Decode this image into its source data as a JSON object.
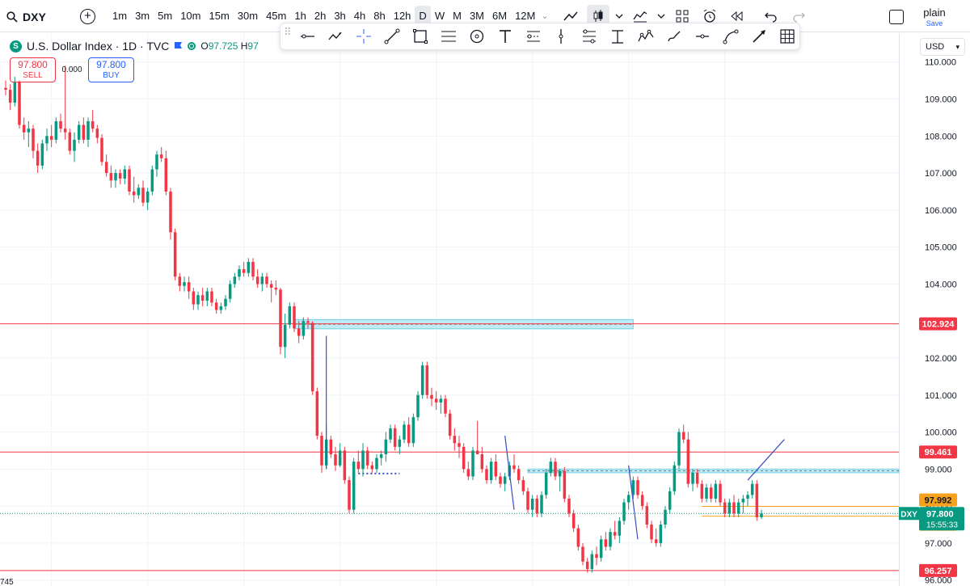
{
  "toolbar": {
    "symbol": "DXY",
    "intervals": [
      "1m",
      "3m",
      "5m",
      "10m",
      "15m",
      "30m",
      "45m",
      "1h",
      "2h",
      "3h",
      "4h",
      "8h",
      "12h",
      "D",
      "W",
      "M",
      "3M",
      "6M",
      "12M"
    ],
    "active_interval": "D",
    "layout_name": "plain",
    "save_label": "Save"
  },
  "legend": {
    "title": "U.S. Dollar Index · 1D · TVC",
    "logo_letter": "S",
    "ohlc_open_key": "O",
    "ohlc_open_value": "97.725",
    "ohlc_high_key": "H",
    "ohlc_high_value": "97"
  },
  "trade": {
    "sell_price": "97.800",
    "sell_label": "SELL",
    "spread": "0.000",
    "buy_price": "97.800",
    "buy_label": "BUY"
  },
  "currency": "USD",
  "bottom_partial_label": "745",
  "colors": {
    "up": "#089981",
    "down": "#f23645",
    "hline": "#f23645",
    "zone": "#71d3e6",
    "orange": "#f7a21b",
    "trend": "#3a4ec4",
    "last_price_bg": "#089981"
  },
  "chart_data": {
    "type": "candlestick",
    "symbol": "DXY",
    "timeframe": "1D",
    "ylim": [
      95.84,
      110.78
    ],
    "y_ticks": [
      110,
      109,
      108,
      107,
      106,
      105,
      104,
      102,
      101,
      100,
      99,
      98,
      97,
      96
    ],
    "y_tick_labels": [
      "110.000",
      "109.000",
      "108.000",
      "107.000",
      "106.000",
      "105.000",
      "104.000",
      "102.000",
      "101.000",
      "100.000",
      "99.000",
      "98.000",
      "97.000",
      "96.000"
    ],
    "horizontal_lines": [
      {
        "price": 102.924,
        "label": "102.924",
        "color": "#f23645"
      },
      {
        "price": 99.461,
        "label": "99.461",
        "color": "#f23645"
      },
      {
        "price": 96.257,
        "label": "96.257",
        "color": "#f23645"
      }
    ],
    "orange_lines": [
      {
        "price": 97.992,
        "label": "97.992"
      },
      {
        "price": 97.727,
        "label": "97.727"
      }
    ],
    "last_price": {
      "symbol": "DXY",
      "price": "97.800",
      "countdown": "15:55:33",
      "value": 97.8
    },
    "zones": [
      {
        "bar_from": 63,
        "bar_to": 137,
        "top": 103.04,
        "bottom": 102.79
      },
      {
        "bar_from": 114,
        "bar_to": 195,
        "top": 99.0,
        "bottom": 98.9
      }
    ],
    "trend_lines": [
      {
        "from_bar": 70,
        "from_price": 99.0,
        "to_bar": 70,
        "to_price": 102.6
      },
      {
        "from_bar": 109,
        "from_price": 99.9,
        "to_bar": 111,
        "to_price": 97.9
      },
      {
        "from_bar": 136,
        "from_price": 99.1,
        "to_bar": 138,
        "to_price": 97.1
      },
      {
        "from_bar": 162,
        "from_price": 98.7,
        "to_bar": 170,
        "to_price": 99.8
      }
    ],
    "dotted_levels": [
      {
        "bar_from": 77,
        "bar_to": 86,
        "price": 98.88
      }
    ],
    "candles": [
      [
        109.3,
        109.5,
        109.1,
        109.25
      ],
      [
        109.25,
        109.4,
        108.7,
        108.9
      ],
      [
        108.9,
        109.6,
        108.8,
        109.45
      ],
      [
        109.45,
        109.5,
        108.2,
        108.3
      ],
      [
        108.3,
        108.5,
        107.9,
        108.1
      ],
      [
        108.1,
        108.4,
        107.7,
        108.2
      ],
      [
        108.2,
        108.3,
        107.4,
        107.6
      ],
      [
        107.6,
        107.8,
        107.0,
        107.2
      ],
      [
        107.2,
        107.9,
        107.1,
        107.8
      ],
      [
        107.8,
        108.2,
        107.6,
        108.0
      ],
      [
        108.0,
        108.3,
        107.7,
        107.9
      ],
      [
        107.9,
        108.5,
        107.8,
        108.4
      ],
      [
        108.4,
        108.6,
        108.1,
        108.2
      ],
      [
        108.2,
        109.9,
        107.9,
        108.1
      ],
      [
        108.1,
        108.2,
        107.5,
        107.6
      ],
      [
        107.6,
        108.1,
        107.3,
        107.9
      ],
      [
        107.9,
        108.4,
        107.8,
        108.3
      ],
      [
        108.3,
        108.5,
        107.8,
        107.9
      ],
      [
        107.9,
        108.5,
        107.7,
        108.4
      ],
      [
        108.4,
        108.7,
        108.1,
        108.2
      ],
      [
        108.2,
        108.3,
        107.8,
        107.95
      ],
      [
        107.95,
        108.05,
        107.2,
        107.3
      ],
      [
        107.3,
        107.5,
        106.9,
        107.0
      ],
      [
        107.0,
        107.2,
        106.6,
        106.8
      ],
      [
        106.8,
        107.1,
        106.6,
        107.0
      ],
      [
        107.0,
        107.1,
        106.7,
        106.85
      ],
      [
        106.85,
        107.2,
        106.7,
        107.1
      ],
      [
        107.1,
        107.2,
        106.4,
        106.5
      ],
      [
        106.5,
        106.9,
        106.2,
        106.4
      ],
      [
        106.4,
        106.7,
        106.3,
        106.6
      ],
      [
        106.6,
        106.8,
        106.1,
        106.2
      ],
      [
        106.2,
        106.6,
        106.0,
        106.5
      ],
      [
        106.5,
        107.2,
        106.4,
        107.1
      ],
      [
        107.1,
        107.6,
        106.9,
        107.5
      ],
      [
        107.5,
        107.7,
        107.3,
        107.4
      ],
      [
        107.4,
        107.6,
        106.4,
        106.5
      ],
      [
        106.5,
        106.6,
        105.2,
        105.4
      ],
      [
        105.4,
        105.5,
        104.1,
        104.2
      ],
      [
        104.2,
        104.3,
        103.8,
        103.95
      ],
      [
        103.95,
        104.2,
        103.8,
        104.05
      ],
      [
        104.05,
        104.2,
        103.6,
        103.8
      ],
      [
        103.8,
        103.9,
        103.3,
        103.45
      ],
      [
        103.45,
        103.8,
        103.3,
        103.7
      ],
      [
        103.7,
        103.9,
        103.4,
        103.55
      ],
      [
        103.55,
        103.9,
        103.4,
        103.8
      ],
      [
        103.8,
        103.9,
        103.4,
        103.5
      ],
      [
        103.5,
        103.6,
        103.2,
        103.3
      ],
      [
        103.3,
        103.5,
        103.2,
        103.4
      ],
      [
        103.4,
        103.7,
        103.3,
        103.6
      ],
      [
        103.6,
        104.1,
        103.5,
        104.0
      ],
      [
        104.0,
        104.3,
        103.9,
        104.2
      ],
      [
        104.2,
        104.5,
        104.1,
        104.4
      ],
      [
        104.4,
        104.6,
        104.2,
        104.3
      ],
      [
        104.3,
        104.7,
        104.2,
        104.6
      ],
      [
        104.6,
        104.7,
        104.1,
        104.2
      ],
      [
        104.2,
        104.4,
        103.9,
        104.0
      ],
      [
        104.0,
        104.3,
        103.8,
        104.2
      ],
      [
        104.2,
        104.3,
        103.9,
        104.0
      ],
      [
        104.0,
        104.1,
        103.5,
        103.9
      ],
      [
        103.9,
        104.1,
        103.7,
        103.85
      ],
      [
        103.85,
        103.9,
        102.1,
        102.3
      ],
      [
        102.3,
        103.2,
        102.0,
        102.9
      ],
      [
        102.9,
        103.5,
        102.8,
        103.4
      ],
      [
        103.4,
        103.5,
        102.7,
        102.8
      ],
      [
        102.8,
        103.0,
        102.4,
        102.6
      ],
      [
        102.6,
        103.1,
        102.5,
        103.0
      ],
      [
        103.0,
        103.1,
        102.8,
        102.95
      ],
      [
        102.95,
        103.0,
        101.0,
        101.1
      ],
      [
        101.1,
        101.2,
        99.8,
        99.9
      ],
      [
        99.9,
        100.0,
        98.9,
        99.1
      ],
      [
        99.1,
        100.2,
        99.0,
        99.8
      ],
      [
        99.8,
        99.9,
        99.3,
        99.4
      ],
      [
        99.4,
        99.6,
        98.95,
        99.1
      ],
      [
        99.1,
        99.7,
        99.05,
        99.5
      ],
      [
        99.5,
        99.6,
        98.6,
        98.7
      ],
      [
        98.7,
        98.8,
        97.8,
        97.9
      ],
      [
        97.9,
        99.3,
        97.8,
        99.2
      ],
      [
        99.2,
        99.5,
        98.9,
        99.0
      ],
      [
        99.0,
        99.7,
        98.8,
        99.5
      ],
      [
        99.5,
        99.6,
        99.0,
        99.1
      ],
      [
        99.1,
        99.2,
        98.9,
        99.0
      ],
      [
        99.0,
        99.4,
        98.9,
        99.3
      ],
      [
        99.3,
        99.5,
        99.1,
        99.4
      ],
      [
        99.4,
        100.0,
        99.2,
        99.8
      ],
      [
        99.8,
        100.2,
        99.7,
        100.1
      ],
      [
        100.1,
        100.2,
        99.5,
        99.6
      ],
      [
        99.6,
        99.9,
        99.4,
        99.8
      ],
      [
        99.8,
        100.3,
        99.7,
        100.2
      ],
      [
        100.2,
        100.4,
        99.6,
        99.7
      ],
      [
        99.7,
        100.5,
        99.6,
        100.4
      ],
      [
        100.4,
        101.1,
        100.3,
        101.0
      ],
      [
        101.0,
        101.9,
        100.9,
        101.8
      ],
      [
        101.8,
        101.9,
        100.9,
        101.0
      ],
      [
        101.0,
        101.2,
        100.7,
        100.9
      ],
      [
        100.9,
        101.1,
        100.6,
        100.8
      ],
      [
        100.8,
        101.0,
        100.5,
        100.9
      ],
      [
        100.9,
        101.0,
        100.4,
        100.5
      ],
      [
        100.5,
        100.6,
        99.8,
        99.9
      ],
      [
        99.9,
        100.1,
        99.5,
        99.7
      ],
      [
        99.7,
        99.9,
        99.3,
        99.6
      ],
      [
        99.6,
        99.7,
        98.9,
        99.0
      ],
      [
        99.0,
        99.2,
        98.7,
        98.8
      ],
      [
        98.8,
        99.6,
        98.7,
        99.5
      ],
      [
        99.5,
        100.3,
        99.4,
        99.4
      ],
      [
        99.4,
        99.6,
        98.9,
        99.0
      ],
      [
        99.0,
        99.1,
        98.6,
        98.7
      ],
      [
        98.7,
        99.3,
        98.6,
        99.2
      ],
      [
        99.2,
        99.4,
        98.7,
        98.8
      ],
      [
        98.8,
        98.9,
        98.5,
        98.6
      ],
      [
        98.6,
        98.9,
        98.4,
        98.8
      ],
      [
        98.8,
        99.2,
        98.7,
        99.1
      ],
      [
        99.1,
        99.4,
        98.9,
        99.0
      ],
      [
        99.0,
        99.1,
        98.6,
        98.7
      ],
      [
        98.7,
        98.8,
        98.3,
        98.4
      ],
      [
        98.4,
        98.5,
        97.8,
        97.9
      ],
      [
        97.9,
        98.3,
        97.7,
        98.2
      ],
      [
        98.2,
        98.3,
        97.7,
        97.8
      ],
      [
        97.8,
        98.4,
        97.7,
        98.3
      ],
      [
        98.3,
        99.0,
        98.2,
        98.9
      ],
      [
        98.9,
        99.3,
        98.8,
        99.2
      ],
      [
        99.2,
        99.3,
        98.7,
        98.8
      ],
      [
        98.8,
        99.0,
        98.4,
        98.95
      ],
      [
        98.95,
        99.05,
        98.1,
        98.2
      ],
      [
        98.2,
        98.3,
        97.7,
        97.8
      ],
      [
        97.8,
        97.9,
        97.3,
        97.4
      ],
      [
        97.4,
        97.5,
        96.8,
        96.9
      ],
      [
        96.9,
        97.0,
        96.4,
        96.5
      ],
      [
        96.5,
        96.6,
        96.2,
        96.3
      ],
      [
        96.3,
        96.8,
        96.2,
        96.7
      ],
      [
        96.7,
        96.9,
        96.4,
        96.6
      ],
      [
        96.6,
        97.2,
        96.5,
        97.1
      ],
      [
        97.1,
        97.3,
        96.8,
        96.9
      ],
      [
        96.9,
        97.4,
        96.8,
        97.3
      ],
      [
        97.3,
        97.6,
        97.1,
        97.2
      ],
      [
        97.2,
        97.7,
        97.0,
        97.6
      ],
      [
        97.6,
        98.2,
        97.5,
        98.1
      ],
      [
        98.1,
        98.4,
        97.9,
        98.3
      ],
      [
        98.3,
        98.8,
        98.2,
        98.7
      ],
      [
        98.7,
        98.8,
        98.2,
        98.3
      ],
      [
        98.3,
        98.4,
        97.9,
        98.0
      ],
      [
        98.0,
        98.1,
        97.4,
        97.5
      ],
      [
        97.5,
        97.6,
        97.0,
        97.1
      ],
      [
        97.1,
        97.4,
        96.9,
        97.0
      ],
      [
        97.0,
        97.6,
        96.9,
        97.5
      ],
      [
        97.5,
        98.0,
        97.4,
        97.9
      ],
      [
        97.9,
        98.5,
        97.8,
        98.4
      ],
      [
        98.4,
        99.2,
        98.3,
        99.1
      ],
      [
        99.1,
        100.1,
        99.0,
        100.0
      ],
      [
        100.0,
        100.2,
        99.7,
        99.8
      ],
      [
        99.8,
        100.0,
        98.5,
        98.6
      ],
      [
        98.6,
        99.0,
        98.4,
        98.9
      ],
      [
        98.9,
        99.0,
        98.5,
        98.6
      ],
      [
        98.6,
        98.7,
        98.1,
        98.2
      ],
      [
        98.2,
        98.6,
        98.1,
        98.5
      ],
      [
        98.5,
        98.6,
        98.1,
        98.2
      ],
      [
        98.2,
        98.7,
        98.1,
        98.6
      ],
      [
        98.6,
        98.7,
        98.0,
        98.1
      ],
      [
        98.1,
        98.2,
        97.7,
        97.8
      ],
      [
        97.8,
        98.2,
        97.7,
        98.1
      ],
      [
        98.1,
        98.3,
        97.7,
        97.8
      ],
      [
        97.8,
        98.2,
        97.7,
        98.1
      ],
      [
        98.1,
        98.3,
        97.8,
        98.2
      ],
      [
        98.2,
        98.4,
        98.0,
        98.3
      ],
      [
        98.3,
        98.7,
        98.2,
        98.6
      ],
      [
        98.6,
        98.7,
        97.6,
        97.7
      ],
      [
        97.7,
        97.9,
        97.65,
        97.8
      ]
    ]
  }
}
